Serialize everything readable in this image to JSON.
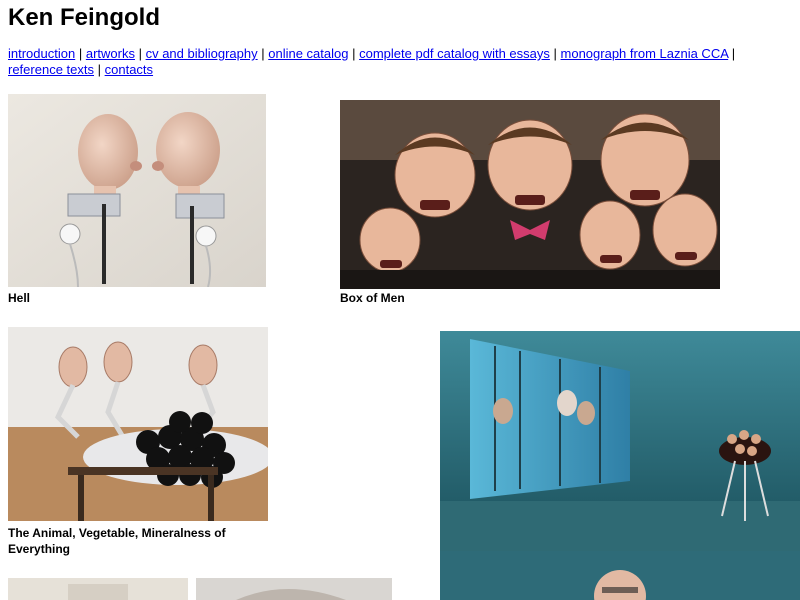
{
  "site": {
    "title": "Ken Feingold"
  },
  "nav": {
    "links": [
      "introduction",
      "artworks",
      "cv and bibliography",
      "online catalog",
      "complete pdf catalog with essays",
      "monograph from Laznia CCA",
      "reference texts",
      "contacts"
    ],
    "separator": "|"
  },
  "artworks": [
    {
      "title": "Hell",
      "image": "two-animatronic-heads-kissing"
    },
    {
      "title": "Box of Men",
      "image": "ventriloquist-dummies"
    },
    {
      "title": "The Animal, Vegetable, Mineralness of Everything",
      "image": "three-heads-on-black-spheres"
    },
    {
      "title": "",
      "image": "gallery-installation-projection"
    }
  ],
  "colors": {
    "link": "#0000ee",
    "background": "#ffffff",
    "text": "#000000"
  }
}
